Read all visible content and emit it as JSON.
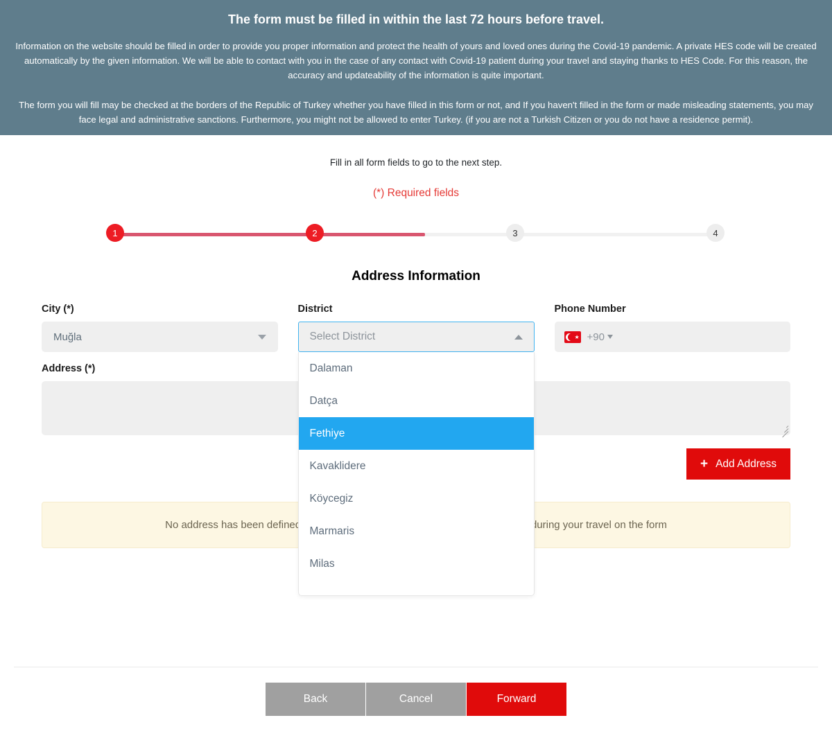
{
  "banner": {
    "title": "The form must be filled in within the last 72 hours before travel.",
    "paragraph1": "Information on the website should be filled in order to provide you proper information and protect the health of yours and loved ones during the Covid-19 pandemic. A private HES code will be created automatically by the given information. We will be able to contact with you in the case of any contact with Covid-19 patient during your travel and staying thanks to HES Code. For this reason, the accuracy and updateability of the information is quite important.",
    "paragraph2": "The form you will fill may be checked at the borders of the Republic of Turkey whether you have filled in this form or not, and If you haven't filled in the form or made misleading statements, you may face legal and administrative sanctions. Furthermore, you might not be allowed to enter Turkey. (if you are not a Turkish Citizen or you do not have a residence permit)."
  },
  "intro": {
    "instruction": "Fill in all form fields to go to the next step.",
    "required_note": "(*) Required fields"
  },
  "stepper": {
    "steps": [
      {
        "number": "1",
        "state": "done"
      },
      {
        "number": "2",
        "state": "done"
      },
      {
        "number": "3",
        "state": "todo"
      },
      {
        "number": "4",
        "state": "todo"
      }
    ]
  },
  "section": {
    "title": "Address Information"
  },
  "form": {
    "city": {
      "label": "City (*)",
      "value": "Muğla"
    },
    "district": {
      "label": "District",
      "placeholder": "Select District",
      "expanded": true,
      "options": [
        "Dalaman",
        "Datça",
        "Fethiye",
        "Kavaklidere",
        "Köycegiz",
        "Marmaris",
        "Milas"
      ],
      "highlighted": "Fethiye"
    },
    "phone": {
      "label": "Phone Number",
      "country_code": "+90",
      "flag": "turkey-flag-icon",
      "value": ""
    },
    "address": {
      "label": "Address (*)",
      "value": ""
    },
    "add_address_button": "Add Address"
  },
  "alert": {
    "message": "No address has been defined yet. Indicate the address and places you will visit during your travel on the form"
  },
  "footer": {
    "back": "Back",
    "cancel": "Cancel",
    "forward": "Forward"
  },
  "colors": {
    "banner_bg": "#5f7d8c",
    "accent_red": "#e00b0b",
    "step_done": "#ed1c24",
    "progress_fill": "#d9566f",
    "highlight_blue": "#22a7f0",
    "focus_border": "#40b3f0",
    "alert_bg": "#fdf7e3",
    "required_red": "#e53935"
  }
}
